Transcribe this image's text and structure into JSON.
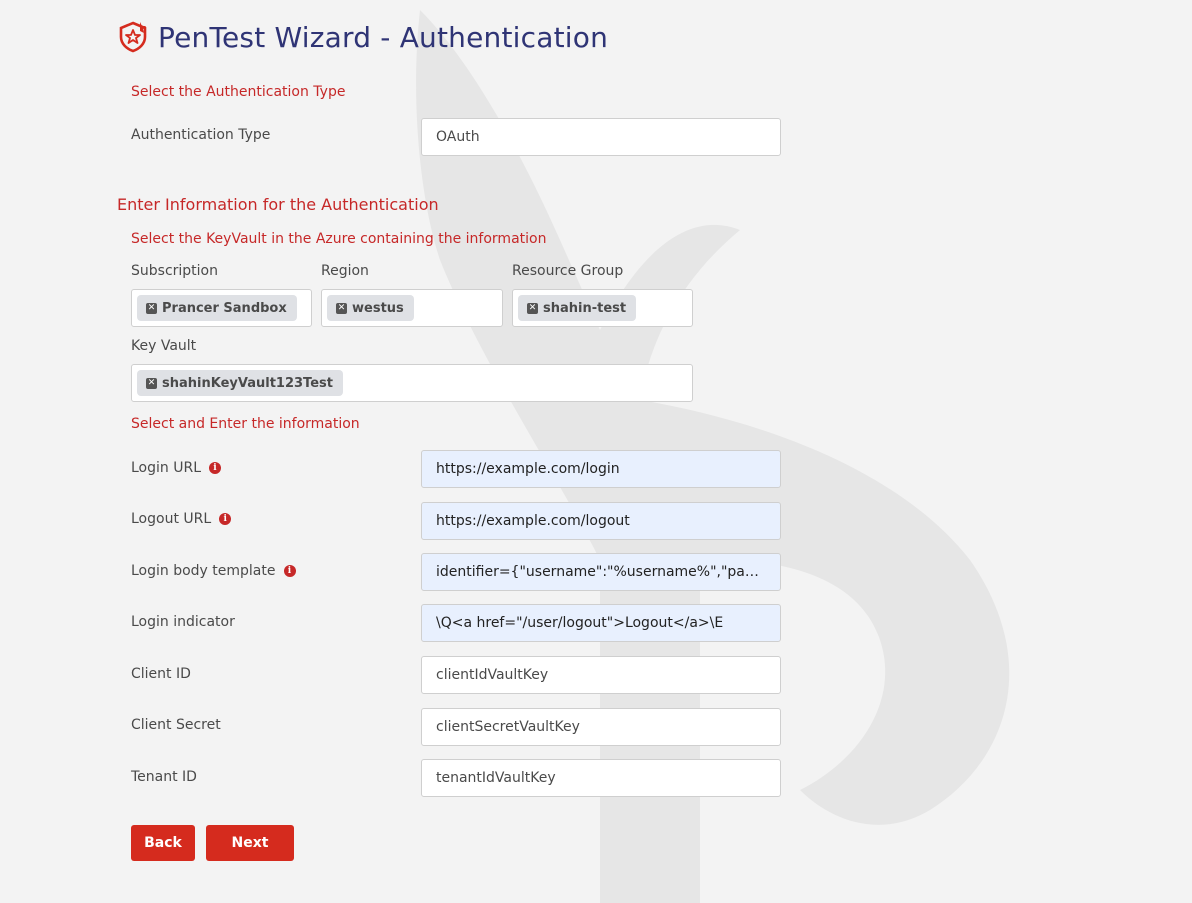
{
  "header": {
    "title": "PenTest Wizard - Authentication"
  },
  "auth_type_section": {
    "heading": "Select the Authentication Type",
    "label": "Authentication Type",
    "value": "OAuth"
  },
  "info_section": {
    "heading": "Enter Information for the Authentication"
  },
  "keyvault_section": {
    "heading": "Select the KeyVault in the Azure containing the information",
    "subscription": {
      "label": "Subscription",
      "chip": "Prancer Sandbox"
    },
    "region": {
      "label": "Region",
      "chip": "westus"
    },
    "resource_group": {
      "label": "Resource Group",
      "chip": "shahin-test"
    },
    "key_vault": {
      "label": "Key Vault",
      "chip": "shahinKeyVault123Test"
    }
  },
  "fields_section": {
    "heading": "Select and Enter the information",
    "login_url": {
      "label": "Login URL",
      "value": "https://example.com/login"
    },
    "logout_url": {
      "label": "Logout URL",
      "value": "https://example.com/logout"
    },
    "login_body_template": {
      "label": "Login body template",
      "value": "identifier={\"username\":\"%username%\",\"password\":\"%password%\"}"
    },
    "login_indicator": {
      "label": "Login indicator",
      "value": "\\Q<a href=\"/user/logout\">Logout</a>\\E"
    },
    "client_id": {
      "label": "Client ID",
      "value": "clientIdVaultKey"
    },
    "client_secret": {
      "label": "Client Secret",
      "value": "clientSecretVaultKey"
    },
    "tenant_id": {
      "label": "Tenant ID",
      "value": "tenantIdVaultKey"
    }
  },
  "buttons": {
    "back": "Back",
    "next": "Next"
  },
  "icons": {
    "logo": "shield-star-icon",
    "info": "info-icon",
    "chip_remove": "close-icon"
  },
  "colors": {
    "accent": "#d52b1e",
    "title": "#2f3475",
    "autofill": "#e8f0fe"
  }
}
